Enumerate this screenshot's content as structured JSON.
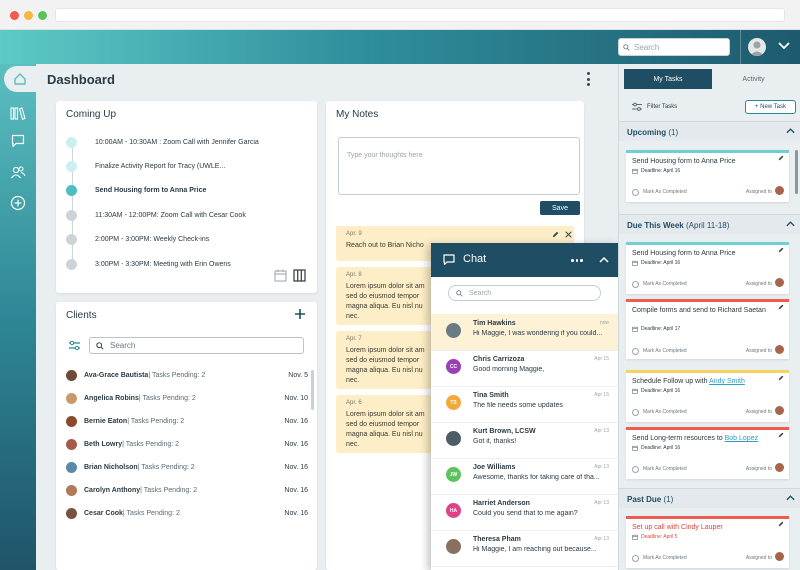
{
  "browser": {
    "dots": [
      "#f05a4f",
      "#f6b63f",
      "#5bc15b"
    ]
  },
  "header": {
    "search_placeholder": "Search"
  },
  "dashboard": {
    "title": "Dashboard"
  },
  "coming_up": {
    "title": "Coming Up",
    "items": [
      {
        "text": "10:00AM - 10:30AM : Zoom Call with Jennifer Garcia",
        "state": "upcoming"
      },
      {
        "text": "Finalize Activity Report for Tracy (UWLE...",
        "state": "upcoming"
      },
      {
        "text": "Send Housing form to Anna Price",
        "state": "current"
      },
      {
        "text": "11:30AM - 12:00PM: Zoom Call with Cesar Cook",
        "state": "past"
      },
      {
        "text": "2:00PM - 3:00PM: Weekly Check-ins",
        "state": "past"
      },
      {
        "text": "3:00PM - 3:30PM: Meeting with Erin Owens",
        "state": "past"
      }
    ]
  },
  "clients": {
    "title": "Clients",
    "search_placeholder": "Search",
    "rows": [
      {
        "name": "Ava-Grace Bautista",
        "pending": " | Tasks Pending: 2",
        "date": "Nov. 5",
        "color": "#6b4a3a"
      },
      {
        "name": "Angelica Robins",
        "pending": " | Tasks Pending: 2",
        "date": "Nov. 10",
        "color": "#c79a6e"
      },
      {
        "name": "Bernie Eaton",
        "pending": " | Tasks Pending: 2",
        "date": "Nov. 16",
        "color": "#8a4b2d"
      },
      {
        "name": "Beth Lowry",
        "pending": " | Tasks Pending: 2",
        "date": "Nov. 16",
        "color": "#a85a4a"
      },
      {
        "name": "Brian Nicholson",
        "pending": " | Tasks Pending: 2",
        "date": "Nov. 16",
        "color": "#5a8aa8"
      },
      {
        "name": "Carolyn Anthony",
        "pending": " | Tasks Pending: 2",
        "date": "Nov. 16",
        "color": "#b07a5a"
      },
      {
        "name": "Cesar Cook",
        "pending": " | Tasks Pending: 2",
        "date": "Nov. 16",
        "color": "#7a5040"
      }
    ]
  },
  "notes": {
    "title": "My Notes",
    "placeholder": "Type your thoughts here",
    "save_label": "Save",
    "items": [
      {
        "date": "Apr. 9",
        "text": "Reach out to Brian Nicho"
      },
      {
        "date": "Apr. 8",
        "text": "Lorem ipsum dolor sit am\nsed do eiusmod tempor\nmagna aliqua. Eu nisl nu\nnec."
      },
      {
        "date": "Apr. 7",
        "text": "Lorem ipsum dolor sit am\nsed do eiusmod tempor\nmagna aliqua. Eu nisl nu\nnec."
      },
      {
        "date": "Apr. 6",
        "text": "Lorem ipsum dolor sit am\nsed do eiusmod tempor\nmagna aliqua. Eu nisl nu\nnec."
      }
    ]
  },
  "chat": {
    "title": "Chat",
    "search_placeholder": "Search",
    "messages": [
      {
        "name": "Tim Hawkins",
        "text": "Hi Maggie, I was wondering if you could...",
        "time": "now",
        "initials": "",
        "color": "#6b7b86",
        "unread": true
      },
      {
        "name": "Chris Carrizoza",
        "text": "Good morning Maggie,",
        "time": "Apr 15",
        "initials": "CC",
        "color": "#9b3fb5",
        "unread": false
      },
      {
        "name": "Tina Smith",
        "text": "The file needs some updates",
        "time": "Apr 15",
        "initials": "TS",
        "color": "#f2a93b",
        "unread": false
      },
      {
        "name": "Kurt Brown, LCSW",
        "text": "Got it, thanks!",
        "time": "Apr 13",
        "initials": "",
        "color": "#4d5d68",
        "unread": false
      },
      {
        "name": "Joe Williams",
        "text": "Awesome, thanks for taking care of tha...",
        "time": "Apr 13",
        "initials": "JW",
        "color": "#5ec25e",
        "unread": false
      },
      {
        "name": "Harriet Anderson",
        "text": "Could you send that to me again?",
        "time": "Apr 13",
        "initials": "HA",
        "color": "#e0428a",
        "unread": false
      },
      {
        "name": "Theresa Pham",
        "text": "Hi Maggie, I am reaching out because...",
        "time": "Apr 13",
        "initials": "",
        "color": "#8a7060",
        "unread": false
      }
    ]
  },
  "tasks": {
    "tab_my_tasks": "My Tasks",
    "tab_activity": "Activity",
    "filter_label": "Filter Tasks",
    "new_task_label": "+ New Task",
    "mark_label": "Mark As Completed",
    "assigned_label": "Assigned to",
    "sections": {
      "upcoming": {
        "label": "Upcoming",
        "count": "(1)"
      },
      "due_this_week": {
        "label": "Due This Week",
        "range": "(April 11-18)"
      },
      "past_due": {
        "label": "Past Due",
        "count": "(1)"
      }
    },
    "cards": [
      {
        "title": "Send Housing form to Anna Price",
        "deadline": "Deadline: April 16",
        "strip": "#6fd0d4"
      },
      {
        "title": "Send Housing form to Anna Price",
        "deadline": "Deadline: April 16",
        "strip": "#6fd0d4"
      },
      {
        "title": "Compile forms and send to Richard Saetan",
        "deadline": "Deadline: April 17",
        "strip": "#f05a4f"
      },
      {
        "title_prefix": "Schedule Follow up with ",
        "title_link": "Andy Smith",
        "deadline": "Deadline: April 16",
        "strip": "#f6d35f"
      },
      {
        "title_prefix": "Send Long-term resources to ",
        "title_link": "Bob Lopez",
        "deadline": "Deadline: April 16",
        "strip": "#f05a4f"
      },
      {
        "title": "Set up call with Cindy Lauper",
        "deadline": "Deadline: April 5",
        "strip": "#f05a4f"
      }
    ]
  }
}
